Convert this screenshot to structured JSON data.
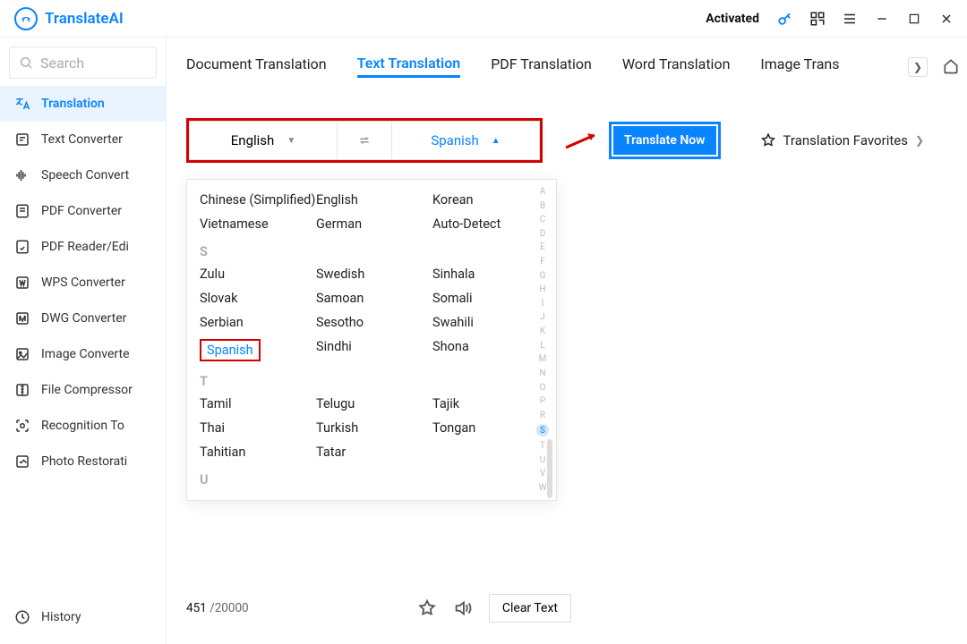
{
  "brand": "TranslateAI",
  "titlebar": {
    "activated": "Activated"
  },
  "search": {
    "placeholder": "Search"
  },
  "sidebar": [
    {
      "label": "Translation",
      "active": true,
      "icon": "translate"
    },
    {
      "label": "Text Converter",
      "icon": "text"
    },
    {
      "label": "Speech Convert",
      "icon": "speech"
    },
    {
      "label": "PDF Converter",
      "icon": "pdf"
    },
    {
      "label": "PDF Reader/Edi",
      "icon": "pdfread"
    },
    {
      "label": "WPS Converter",
      "icon": "wps"
    },
    {
      "label": "DWG Converter",
      "icon": "dwg"
    },
    {
      "label": "Image Converte",
      "icon": "image"
    },
    {
      "label": "File Compressor",
      "icon": "compress"
    },
    {
      "label": "Recognition To",
      "icon": "recog"
    },
    {
      "label": "Photo Restorati",
      "icon": "photo"
    }
  ],
  "sidebar_history": "History",
  "tabs": [
    "Document Translation",
    "Text Translation",
    "PDF Translation",
    "Word Translation",
    "Image Trans"
  ],
  "activeTab": 1,
  "lang": {
    "source": "English",
    "target": "Spanish"
  },
  "translate_btn": "Translate Now",
  "favorites": "Translation Favorites",
  "dropdown": {
    "recent": [
      [
        "Chinese (Simplified)",
        "English",
        "Korean"
      ],
      [
        "Vietnamese",
        "German",
        "Auto-Detect"
      ]
    ],
    "sections": [
      {
        "letter": "S",
        "rows": [
          [
            "Zulu",
            "Swedish",
            "Sinhala"
          ],
          [
            "Slovak",
            "Samoan",
            "Somali"
          ],
          [
            "Serbian",
            "Sesotho",
            "Swahili"
          ],
          [
            "Spanish",
            "Sindhi",
            "Shona"
          ]
        ],
        "highlight": "Spanish"
      },
      {
        "letter": "T",
        "rows": [
          [
            "Tamil",
            "Telugu",
            "Tajik"
          ],
          [
            "Thai",
            "Turkish",
            "Tongan"
          ],
          [
            "Tahitian",
            "Tatar",
            ""
          ]
        ]
      },
      {
        "letter": "U",
        "rows": []
      }
    ],
    "alphabet": [
      "A",
      "B",
      "C",
      "D",
      "E",
      "F",
      "G",
      "H",
      "I",
      "J",
      "K",
      "L",
      "M",
      "N",
      "O",
      "P",
      "R",
      "S",
      "T",
      "U",
      "V",
      "W"
    ],
    "alphabet_selected": "S"
  },
  "footer": {
    "count_current": "451",
    "count_sep": " /",
    "count_max": "20000",
    "clear": "Clear Text"
  }
}
